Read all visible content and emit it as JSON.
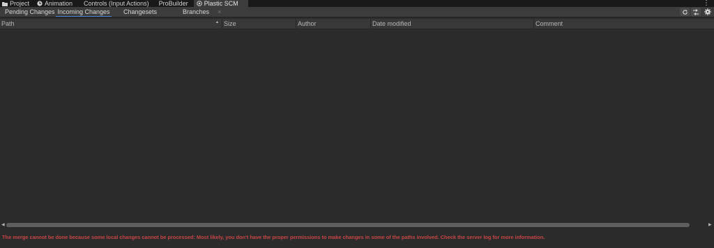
{
  "window_tabs": [
    {
      "label": "Project",
      "icon": "folder-icon"
    },
    {
      "label": "Animation",
      "icon": "animation-icon"
    },
    {
      "label": "Controls (Input Actions)",
      "icon": ""
    },
    {
      "label": "ProBuilder",
      "icon": ""
    },
    {
      "label": "Plastic SCM",
      "icon": "plastic-scm-icon",
      "active": true
    }
  ],
  "kebab": "⋮",
  "subtabs": {
    "pending": "Pending Changes",
    "incoming": "Incoming Changes",
    "changesets": "Changesets",
    "branches": "Branches",
    "close": "×"
  },
  "table": {
    "columns": [
      "Path",
      "Size",
      "Author",
      "Date modified",
      "Comment"
    ],
    "sorted_column": "Path",
    "rows": []
  },
  "status": {
    "message": "The merge cannot be done because some local changes cannot be processed: Most likely, you don't have the proper permissions to make changes in some of the paths involved. Check the server log for more information.",
    "color": "#c54545"
  },
  "colors": {
    "accent": "#4b89dc",
    "background": "#2b2b2b",
    "toolbar": "#3c3c3c"
  }
}
